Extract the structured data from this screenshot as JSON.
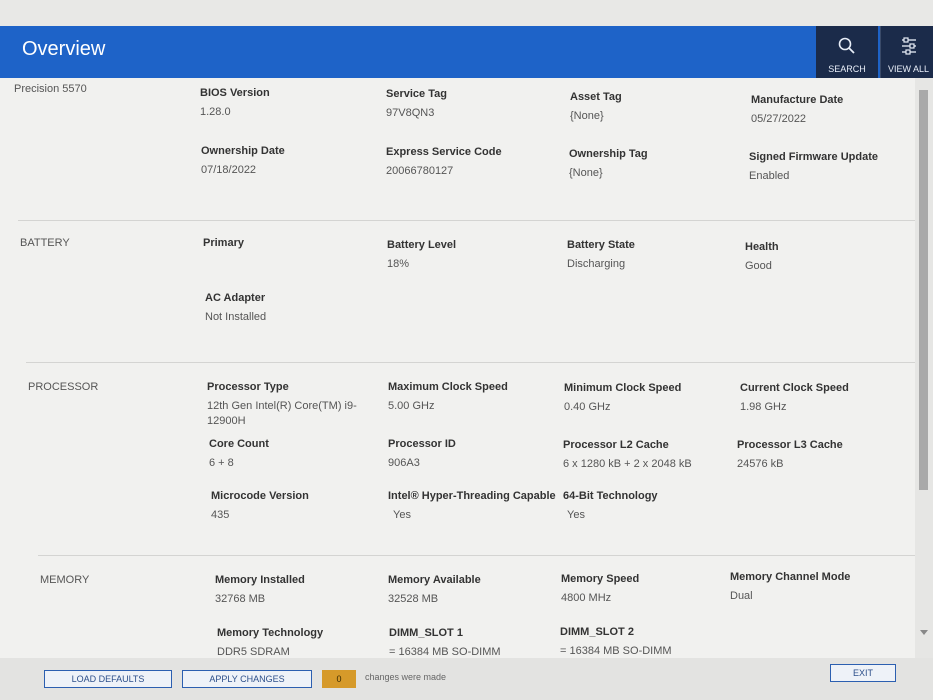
{
  "header": {
    "title": "Overview",
    "search_label": "SEARCH",
    "viewall_label": "VIEW ALL"
  },
  "system": {
    "model": "Precision 5570",
    "fields": [
      {
        "key": "BIOS Version",
        "value": "1.28.0"
      },
      {
        "key": "Service Tag",
        "value": "97V8QN3"
      },
      {
        "key": "Asset Tag",
        "value": "{None}"
      },
      {
        "key": "Manufacture Date",
        "value": "05/27/2022"
      },
      {
        "key": "Ownership Date",
        "value": "07/18/2022"
      },
      {
        "key": "Express Service Code",
        "value": "20066780127"
      },
      {
        "key": "Ownership Tag",
        "value": "{None}"
      },
      {
        "key": "Signed Firmware Update",
        "value": "Enabled"
      }
    ]
  },
  "battery": {
    "label": "BATTERY",
    "fields": [
      {
        "key": "Primary",
        "value": ""
      },
      {
        "key": "Battery Level",
        "value": "18%"
      },
      {
        "key": "Battery State",
        "value": "Discharging"
      },
      {
        "key": "Health",
        "value": "Good"
      },
      {
        "key": "AC Adapter",
        "value": "Not Installed"
      }
    ]
  },
  "processor": {
    "label": "PROCESSOR",
    "fields": [
      {
        "key": "Processor Type",
        "value": "12th Gen Intel(R) Core(TM) i9-12900H"
      },
      {
        "key": "Maximum Clock Speed",
        "value": "5.00 GHz"
      },
      {
        "key": "Minimum Clock Speed",
        "value": "0.40 GHz"
      },
      {
        "key": "Current Clock Speed",
        "value": "1.98 GHz"
      },
      {
        "key": "Core Count",
        "value": "6 + 8"
      },
      {
        "key": "Processor ID",
        "value": "906A3"
      },
      {
        "key": "Processor L2 Cache",
        "value": "6 x 1280  kB + 2 x 2048  kB"
      },
      {
        "key": "Processor L3 Cache",
        "value": "24576 kB"
      },
      {
        "key": "Microcode Version",
        "value": "435"
      },
      {
        "key": "Intel® Hyper-Threading Capable",
        "value": "Yes"
      },
      {
        "key": "64-Bit Technology",
        "value": "Yes"
      }
    ]
  },
  "memory": {
    "label": "MEMORY",
    "fields": [
      {
        "key": "Memory Installed",
        "value": "32768 MB"
      },
      {
        "key": "Memory Available",
        "value": "32528 MB"
      },
      {
        "key": "Memory Speed",
        "value": "4800 MHz"
      },
      {
        "key": "Memory Channel Mode",
        "value": "Dual"
      },
      {
        "key": "Memory Technology",
        "value": "DDR5 SDRAM"
      },
      {
        "key": "DIMM_SLOT 1",
        "value": "= 16384 MB SO-DIMM"
      },
      {
        "key": "DIMM_SLOT 2",
        "value": "= 16384 MB SO-DIMM"
      }
    ]
  },
  "footer": {
    "load_defaults": "LOAD DEFAULTS",
    "apply_changes": "APPLY CHANGES",
    "changes_count": "0",
    "changes_text": "changes were made",
    "exit": "EXIT"
  }
}
